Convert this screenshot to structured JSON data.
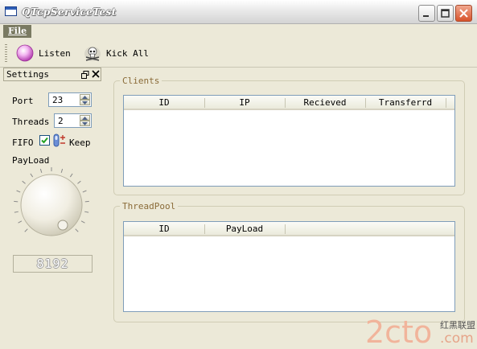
{
  "window": {
    "title": "QTcpServiceTest",
    "minimize_icon": "minimize-icon",
    "maximize_icon": "maximize-icon",
    "close_icon": "close-icon"
  },
  "menu": {
    "file_label": "File"
  },
  "toolbar": {
    "listen_label": "Listen",
    "kick_all_label": "Kick All",
    "listen_icon": "pink-orb-icon",
    "kick_all_icon": "skull-icon"
  },
  "settings": {
    "title": "Settings",
    "port_label": "Port",
    "port_value": "23",
    "threads_label": "Threads",
    "threads_value": "2",
    "fifo_label": "FIFO",
    "fifo_checked": true,
    "keep_label": "Keep",
    "payload_label": "PayLoad",
    "payload_display": "8192"
  },
  "clients": {
    "title": "Clients",
    "columns": [
      "ID",
      "IP",
      "Recieved",
      "Transferrd"
    ],
    "rows": []
  },
  "threadpool": {
    "title": "ThreadPool",
    "columns": [
      "ID",
      "PayLoad"
    ],
    "rows": []
  },
  "watermark": {
    "text": "2cto",
    "suffix": ".com",
    "cn_text": "红黑联盟"
  },
  "colors": {
    "group_title": "#8a6b38",
    "window_bg": "#ece9d8",
    "close_button": "#d8532b",
    "table_border": "#7f9db9"
  }
}
